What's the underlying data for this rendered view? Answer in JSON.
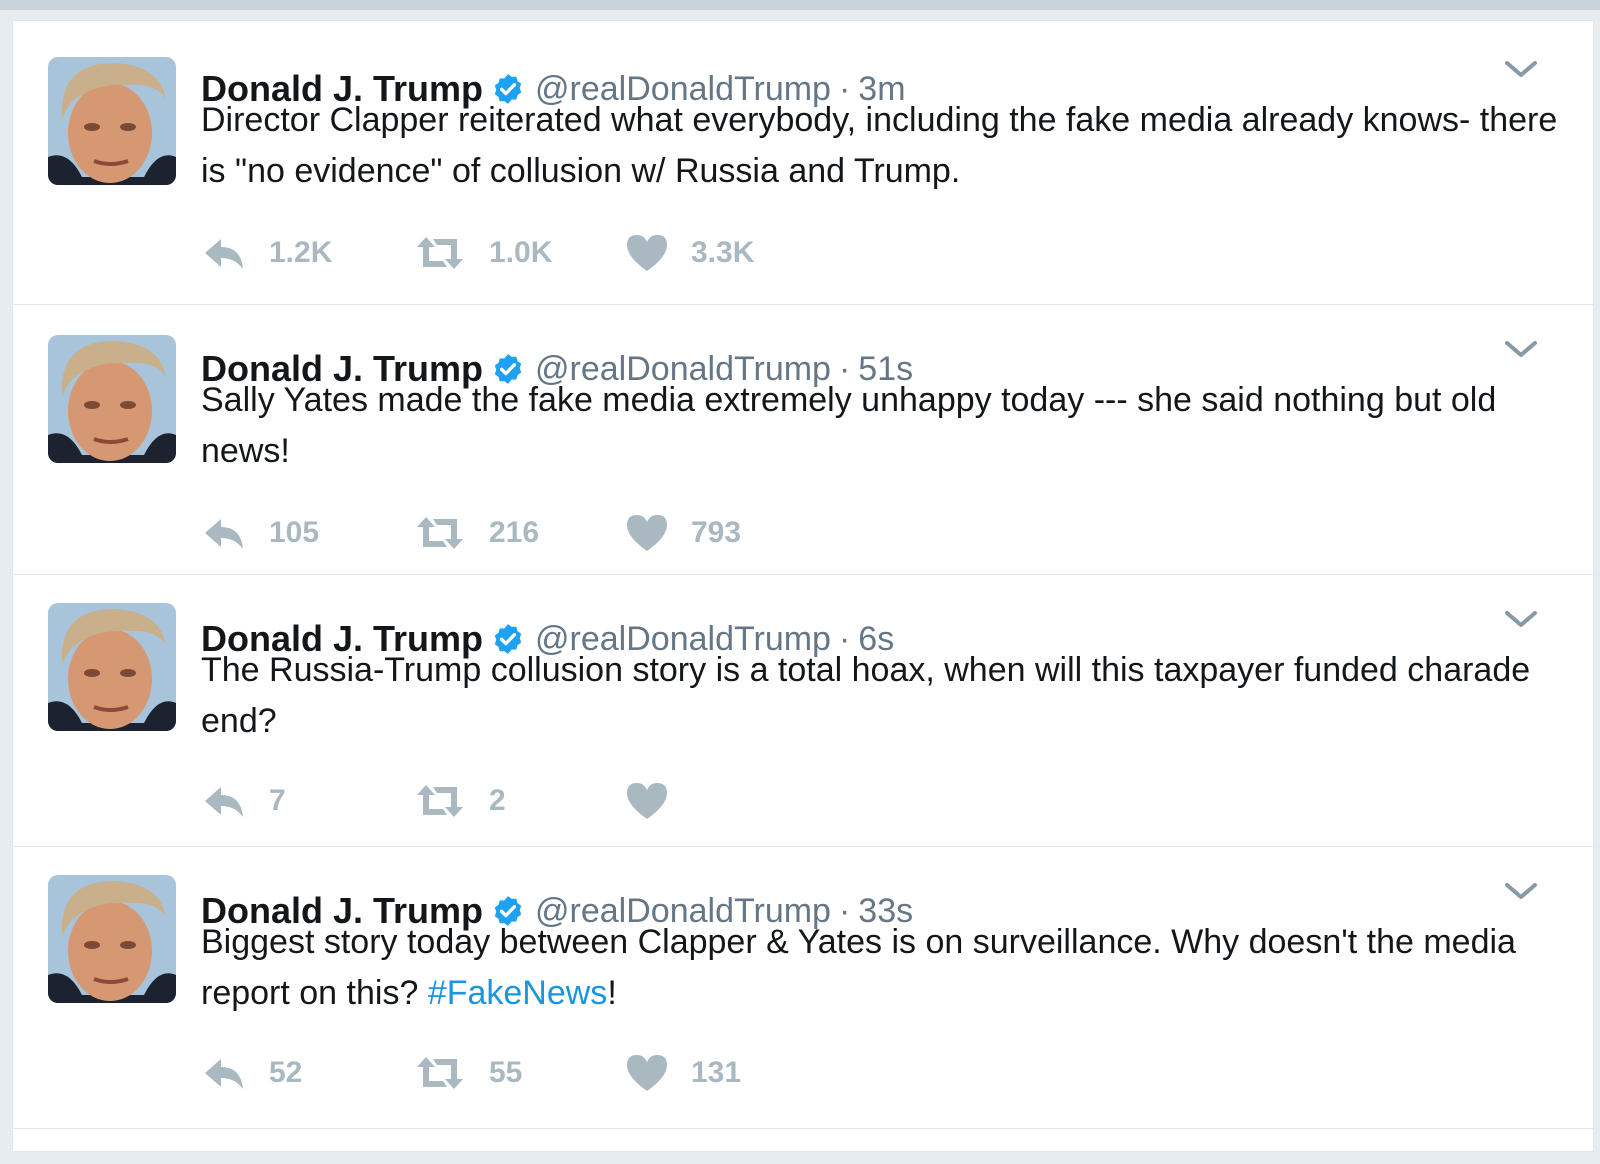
{
  "tweets": [
    {
      "name": "Donald J. Trump",
      "handle": "@realDonaldTrump",
      "separator": "·",
      "time": "3m",
      "text": "Director Clapper reiterated what everybody, including the fake media already knows- there is \"no evidence\" of collusion w/ Russia and Trump.",
      "hashtag": "",
      "text_after_hashtag": "",
      "replies": "1.2K",
      "retweets": "1.0K",
      "likes": "3.3K"
    },
    {
      "name": "Donald J. Trump",
      "handle": "@realDonaldTrump",
      "separator": "·",
      "time": "51s",
      "text": "Sally Yates made the fake media extremely unhappy today --- she said nothing but old news!",
      "hashtag": "",
      "text_after_hashtag": "",
      "replies": "105",
      "retweets": "216",
      "likes": "793"
    },
    {
      "name": "Donald J. Trump",
      "handle": "@realDonaldTrump",
      "separator": "·",
      "time": "6s",
      "text": "The Russia-Trump collusion story is a total hoax, when will this taxpayer funded charade end?",
      "hashtag": "",
      "text_after_hashtag": "",
      "replies": "7",
      "retweets": "2",
      "likes": ""
    },
    {
      "name": "Donald J. Trump",
      "handle": "@realDonaldTrump",
      "separator": "·",
      "time": "33s",
      "text": "Biggest story today between Clapper & Yates is on surveillance. Why doesn't the media report on this? ",
      "hashtag": "#FakeNews",
      "text_after_hashtag": "!",
      "replies": "52",
      "retweets": "55",
      "likes": "131"
    }
  ],
  "icons": {
    "verified": "verified-badge-icon",
    "reply": "reply-icon",
    "retweet": "retweet-icon",
    "like": "heart-icon",
    "menu": "chevron-down-icon"
  },
  "colors": {
    "verified_blue": "#1da1f2",
    "hashtag_blue": "#1b95e0",
    "action_gray": "#aab8c2",
    "meta_gray": "#657786"
  }
}
